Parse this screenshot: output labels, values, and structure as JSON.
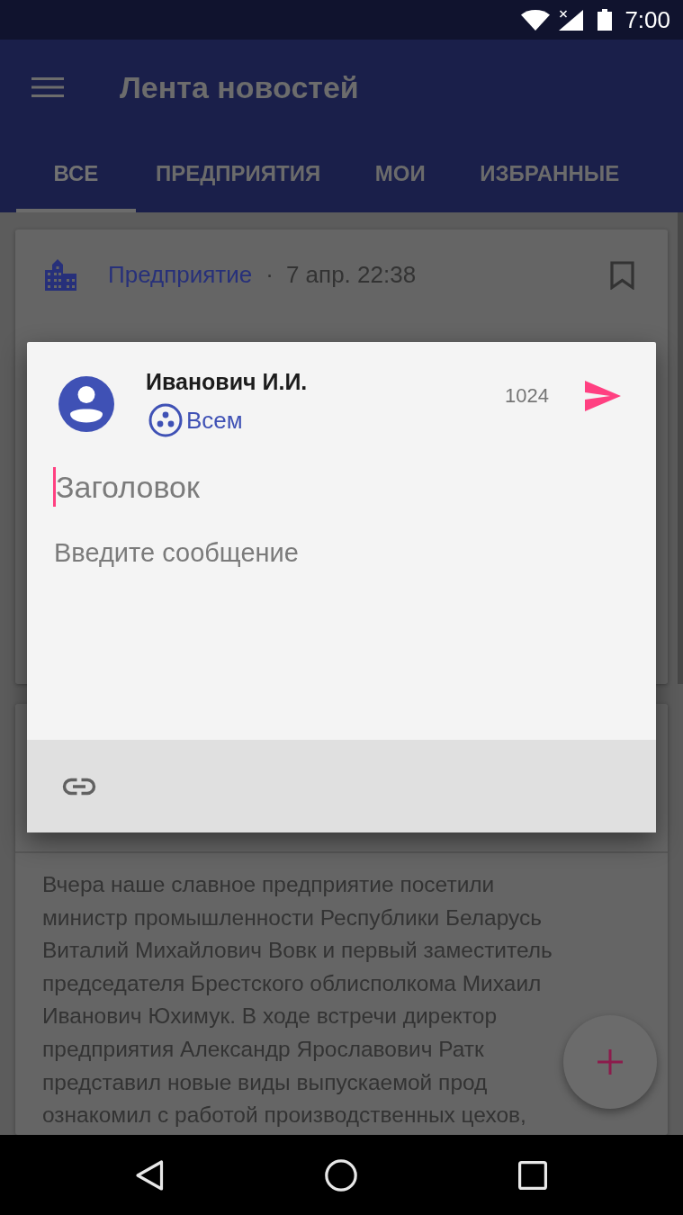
{
  "status_bar": {
    "time": "7:00"
  },
  "app_bar": {
    "title": "Лента новостей"
  },
  "tabs": [
    {
      "label": "ВСЕ",
      "selected": true
    },
    {
      "label": "ПРЕДПРИЯТИЯ",
      "selected": false
    },
    {
      "label": "МОИ",
      "selected": false
    },
    {
      "label": "ИЗБРАННЫЕ",
      "selected": false
    }
  ],
  "posts": [
    {
      "kind": "headline",
      "category": "Предприятие",
      "separator": "·",
      "date": "7 апр. 22:38",
      "bookmarked": false
    },
    {
      "kind": "excerpt",
      "text": "Вчера наше славное предприятие посетили\nминистр промышленности Республики Беларусь\nВиталий Михайлович Вовк и первый заместитель\nпредседателя Брестского облисполкома Михаил\nИванович Юхимук. В ходе встречи директор\nпредприятия Александр Ярославович Ратк\nпредставил новые виды выпускаемой прод\nознакомил с работой производственных цехов,"
    }
  ],
  "compose_dialog": {
    "author": "Иванович И.И.",
    "audience": "Всем",
    "counter": "1024",
    "title_field": {
      "placeholder": "Заголовок",
      "focused": true
    },
    "message_field": {
      "placeholder": "Введите сообщение"
    }
  }
}
